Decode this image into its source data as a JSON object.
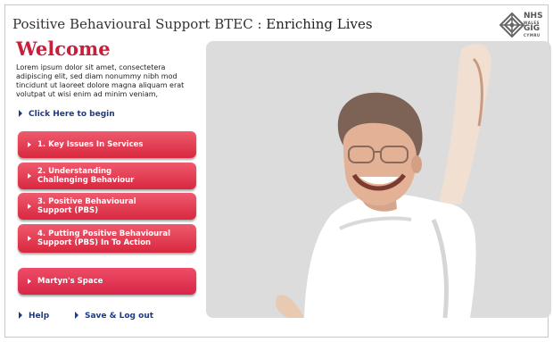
{
  "header": {
    "title_prefix": "Positive Behavioural Support BTEC : ",
    "title_suffix": "Enriching Lives",
    "logo": {
      "line1": "NHS",
      "line2": "WALES",
      "line3": "GIG",
      "line4": "CYMRU"
    }
  },
  "welcome": {
    "heading": "Welcome",
    "intro": "Lorem ipsum dolor sit amet, consectetera adipiscing elit, sed diam nonummy nibh mod tincidunt ut laoreet dolore magna aliquam erat volutpat ut wisi enim ad minim veniam,",
    "begin_link": "Click Here to begin"
  },
  "menu": [
    {
      "label": "1. Key Issues In Services"
    },
    {
      "label": "2. Understanding\nChallenging Behaviour"
    },
    {
      "label": "3. Positive Behavioural\nSupport (PBS)"
    },
    {
      "label": "4. Putting Positive Behavioural\nSupport (PBS) In To Action"
    },
    {
      "label": "Martyn's Space"
    }
  ],
  "footer": {
    "help": "Help",
    "save_logout": "Save & Log out"
  },
  "colors": {
    "accent_red": "#c8203b",
    "button_red": "#e03a52",
    "link_blue": "#1d3a8a"
  },
  "icons": {
    "logo": "nhs-wales-diamond-icon",
    "arrow": "triangle-right-icon",
    "photo": "person-raising-arm-illustration"
  }
}
